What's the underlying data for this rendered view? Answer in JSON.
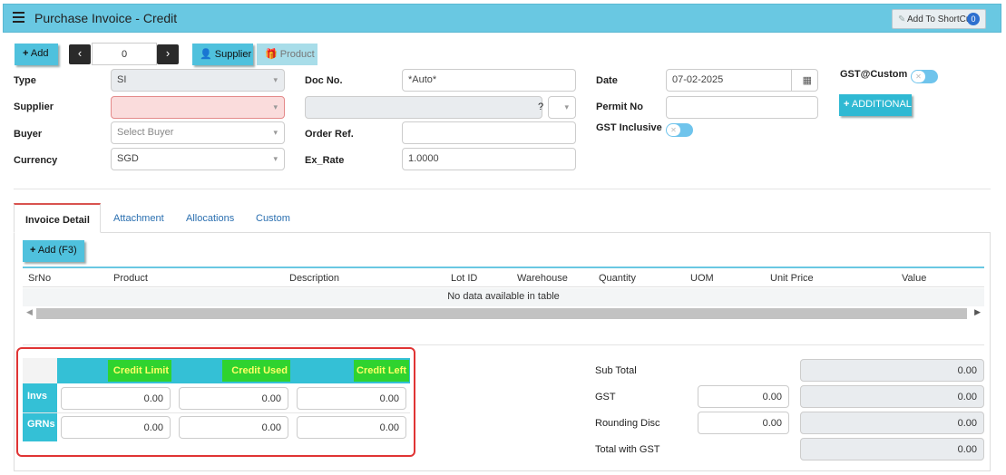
{
  "header": {
    "title": "Purchase Invoice - Credit",
    "shortcut_label": "Add To ShortCut",
    "shortcut_count": "0"
  },
  "toolbar": {
    "add_label": "Add",
    "record_index": "0",
    "supplier_label": "Supplier",
    "product_label": "Product"
  },
  "form": {
    "type_label": "Type",
    "type_value": "SI",
    "supplier_label": "Supplier",
    "supplier_value": "",
    "buyer_label": "Buyer",
    "buyer_placeholder": "Select Buyer",
    "currency_label": "Currency",
    "currency_value": "SGD",
    "docno_label": "Doc No.",
    "docno_value": "*Auto*",
    "supplier_code_q": "?",
    "orderref_label": "Order Ref.",
    "orderref_value": "",
    "exrate_label": "Ex_Rate",
    "exrate_value": "1.0000",
    "date_label": "Date",
    "date_value": "07-02-2025",
    "permit_label": "Permit No",
    "permit_value": "",
    "gst_inclusive_label": "GST Inclusive",
    "gst_custom_label": "GST@Custom",
    "additional_label": "ADDITIONAL"
  },
  "tabs": [
    {
      "label": "Invoice Detail"
    },
    {
      "label": "Attachment"
    },
    {
      "label": "Allocations"
    },
    {
      "label": "Custom"
    }
  ],
  "detail": {
    "add_label": "Add (F3)",
    "columns": [
      "SrNo",
      "Product",
      "Description",
      "Lot ID",
      "Warehouse",
      "Quantity",
      "UOM",
      "Unit Price",
      "Value"
    ],
    "empty_message": "No data available in table"
  },
  "credit": {
    "headers": [
      "Credit Limit",
      "Credit Used",
      "Credit Left"
    ],
    "rows": [
      {
        "label": "Invs",
        "values": [
          "0.00",
          "0.00",
          "0.00"
        ]
      },
      {
        "label": "GRNs",
        "values": [
          "0.00",
          "0.00",
          "0.00"
        ]
      }
    ]
  },
  "totals": {
    "subtotal_label": "Sub Total",
    "subtotal_value": "0.00",
    "gst_label": "GST",
    "gst_rate": "0.00",
    "gst_value": "0.00",
    "rounding_label": "Rounding Disc",
    "rounding_rate": "0.00",
    "rounding_value": "0.00",
    "total_label": "Total with GST",
    "total_value": "0.00"
  },
  "colors": {
    "title_bar": "#69c8e2",
    "button": "#4fc1dd",
    "credit_header": "#2fd32f",
    "credit_header_text": "#ffff66",
    "highlight_border": "#e03434"
  },
  "icons": [
    "hamburger-menu-icon",
    "pencil-icon",
    "plus-icon",
    "chevron-left-icon",
    "chevron-right-icon",
    "user-icon",
    "gift-icon",
    "calendar-icon",
    "caret-down-icon"
  ]
}
